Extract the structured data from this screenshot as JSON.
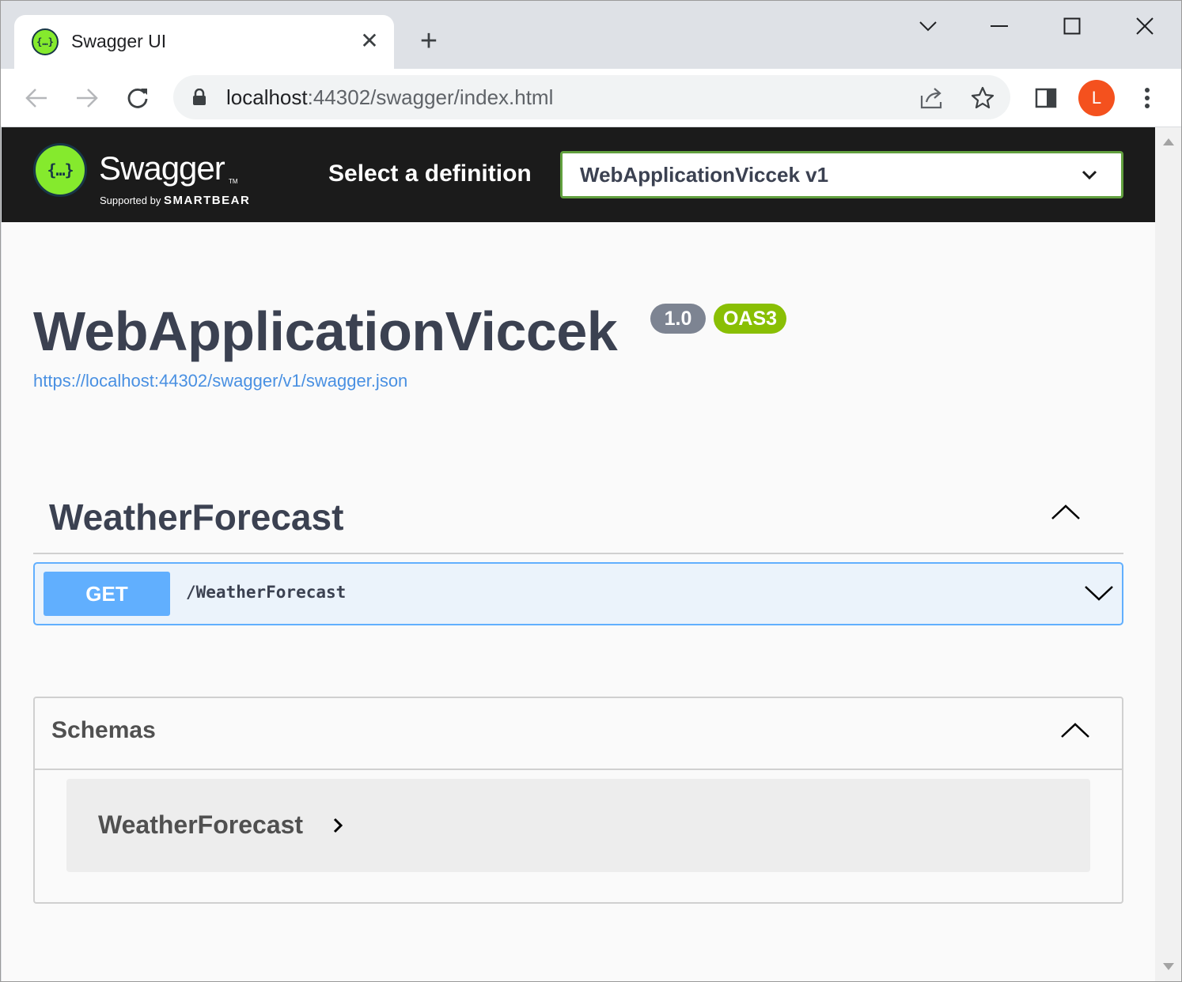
{
  "browser": {
    "tab": {
      "title": "Swagger UI",
      "favicon_text": "{…}",
      "close_glyph": "✕"
    },
    "new_tab_glyph": "+",
    "address": {
      "host": "localhost",
      "rest": ":44302/swagger/index.html"
    },
    "avatar_letter": "L",
    "icons": [
      "back-icon",
      "forward-icon",
      "reload-icon",
      "lock-icon",
      "share-icon",
      "star-icon",
      "side-panel-icon",
      "menu-icon",
      "minimize-icon",
      "maximize-icon",
      "close-icon",
      "tab-search-icon"
    ]
  },
  "topbar": {
    "logo_glyph": "{…}",
    "brand": "Swagger",
    "supported_by": "Supported by",
    "company": "SMARTBEAR",
    "select_label": "Select a definition",
    "selected_definition": "WebApplicationViccek v1",
    "colors": {
      "background": "#1b1b1b",
      "select_border": "#62a03f",
      "logo": "#85ea2d"
    }
  },
  "info": {
    "title": "WebApplicationViccek",
    "version": "1.0",
    "oas_badge": "OAS3",
    "spec_url": "https://localhost:44302/swagger/v1/swagger.json"
  },
  "tags": [
    {
      "name": "WeatherForecast",
      "expanded": true,
      "operations": [
        {
          "method": "GET",
          "path": "/WeatherForecast",
          "color": "#61affe"
        }
      ]
    }
  ],
  "schemas": {
    "title": "Schemas",
    "expanded": true,
    "models": [
      {
        "name": "WeatherForecast"
      }
    ]
  }
}
